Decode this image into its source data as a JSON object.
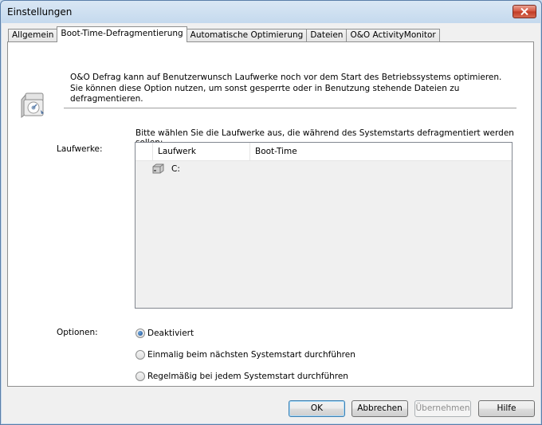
{
  "window": {
    "title": "Einstellungen"
  },
  "tabs": [
    {
      "label": "Allgemein",
      "active": false
    },
    {
      "label": "Boot-Time-Defragmentierung",
      "active": true
    },
    {
      "label": "Automatische Optimierung",
      "active": false
    },
    {
      "label": "Dateien",
      "active": false
    },
    {
      "label": "O&O ActivityMonitor",
      "active": false
    }
  ],
  "panel": {
    "description": "O&O Defrag kann auf Benutzerwunsch Laufwerke noch vor dem Start des Betriebssystems optimieren. Sie können diese Option nutzen, um sonst gesperrte oder in Benutzung stehende Dateien zu defragmentieren.",
    "drives_label": "Laufwerke:",
    "instruction": "Bitte wählen Sie die Laufwerke aus, die während des Systemstarts defragmentiert werden sollen:",
    "list": {
      "columns": [
        "",
        "Laufwerk",
        "Boot-Time"
      ],
      "rows": [
        {
          "drive": "C:",
          "boot_time": ""
        }
      ]
    },
    "options_label": "Optionen:",
    "options": [
      {
        "label": "Deaktiviert",
        "selected": true
      },
      {
        "label": "Einmalig beim nächsten Systemstart durchführen",
        "selected": false
      },
      {
        "label": "Regelmäßig bei jedem Systemstart durchführen",
        "selected": false
      }
    ]
  },
  "buttons": {
    "ok": "OK",
    "cancel": "Abbrechen",
    "apply": "Übernehmen",
    "help": "Hilfe"
  },
  "icons": {
    "close": "close-icon",
    "header": "boot-defrag-icon",
    "drive": "hard-drive-icon"
  }
}
